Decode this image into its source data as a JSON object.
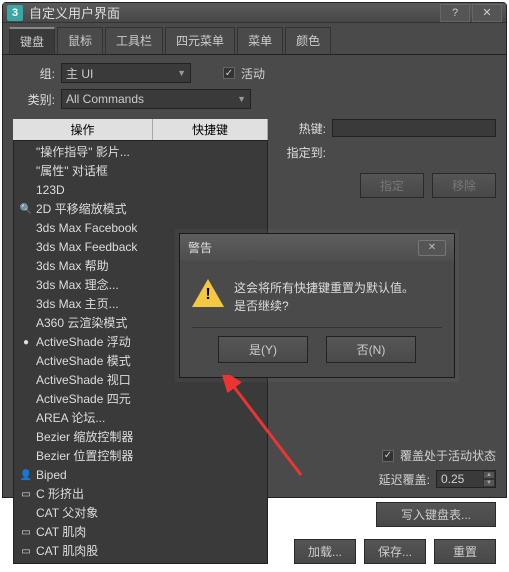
{
  "window": {
    "app_icon_text": "3",
    "title": "自定义用户界面"
  },
  "tabs": [
    "键盘",
    "鼠标",
    "工具栏",
    "四元菜单",
    "菜单",
    "颜色"
  ],
  "group": {
    "label": "组:",
    "value": "主 UI",
    "active_checkbox_label": "活动"
  },
  "category": {
    "label": "类别:",
    "value": "All Commands"
  },
  "list_headers": {
    "action": "操作",
    "shortcut": "快捷键"
  },
  "list_items": [
    {
      "label": "\"操作指导\" 影片...",
      "icon": ""
    },
    {
      "label": "\"属性\" 对话框",
      "icon": ""
    },
    {
      "label": "123D",
      "icon": ""
    },
    {
      "label": "2D 平移缩放模式",
      "icon": "🔍"
    },
    {
      "label": "3ds Max Facebook",
      "icon": ""
    },
    {
      "label": "3ds Max Feedback",
      "icon": ""
    },
    {
      "label": "3ds Max 帮助",
      "icon": ""
    },
    {
      "label": "3ds Max 理念...",
      "icon": ""
    },
    {
      "label": "3ds Max 主页...",
      "icon": ""
    },
    {
      "label": "A360 云渲染模式",
      "icon": ""
    },
    {
      "label": "ActiveShade 浮动",
      "icon": "●"
    },
    {
      "label": "ActiveShade 模式",
      "icon": ""
    },
    {
      "label": "ActiveShade 视口",
      "icon": ""
    },
    {
      "label": "ActiveShade 四元",
      "icon": ""
    },
    {
      "label": "AREA 论坛...",
      "icon": ""
    },
    {
      "label": "Bezier 缩放控制器",
      "icon": ""
    },
    {
      "label": "Bezier 位置控制器",
      "icon": ""
    },
    {
      "label": "Biped",
      "icon": "👤"
    },
    {
      "label": "C 形挤出",
      "icon": "▭"
    },
    {
      "label": "CAT 父对象",
      "icon": ""
    },
    {
      "label": "CAT 肌肉",
      "icon": "▭"
    },
    {
      "label": "CAT 肌肉股",
      "icon": "▭"
    }
  ],
  "right": {
    "hotkey_label": "热键:",
    "assigned_label": "指定到:",
    "assign_btn": "指定",
    "remove_btn": "移除",
    "overlay_cb_label": "覆盖处于活动状态",
    "delay_label": "延迟覆盖:",
    "delay_value": "0.25",
    "write_btn": "写入键盘表...",
    "load_btn": "加载...",
    "save_btn": "保存...",
    "reset_btn": "重置"
  },
  "dialog": {
    "title": "警告",
    "msg_line1": "这会将所有快捷键重置为默认值。",
    "msg_line2": "是否继续?",
    "yes_btn": "是(Y)",
    "no_btn": "否(N)"
  }
}
